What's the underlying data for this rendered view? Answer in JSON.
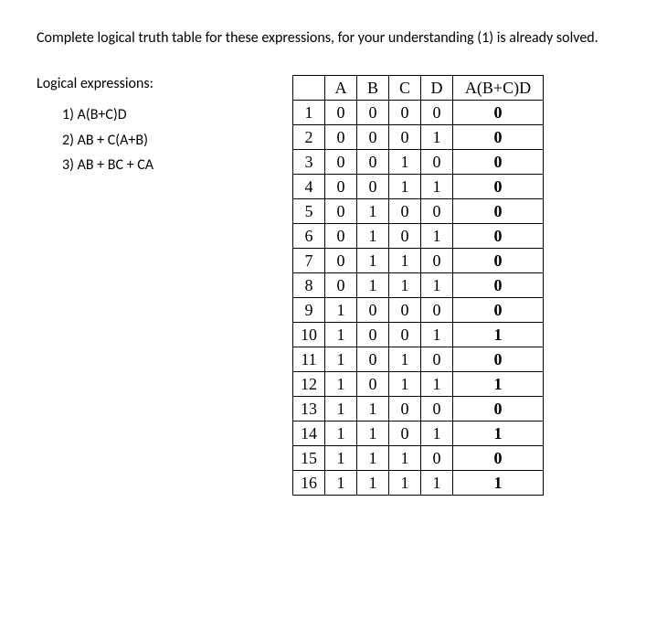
{
  "intro": "Complete logical truth table for these expressions, for your understanding (1) is already solved.",
  "subheading": "Logical expressions:",
  "expressions": [
    {
      "num": "1)",
      "text": "A(B+C)D"
    },
    {
      "num": "2)",
      "text": "AB + C(A+B)"
    },
    {
      "num": "3)",
      "text": "AB + BC + CA"
    }
  ],
  "table": {
    "headers": [
      "A",
      "B",
      "C",
      "D",
      "A(B+C)D"
    ],
    "rows": [
      {
        "n": "1",
        "A": "0",
        "B": "0",
        "C": "0",
        "D": "0",
        "R": "0"
      },
      {
        "n": "2",
        "A": "0",
        "B": "0",
        "C": "0",
        "D": "1",
        "R": "0"
      },
      {
        "n": "3",
        "A": "0",
        "B": "0",
        "C": "1",
        "D": "0",
        "R": "0"
      },
      {
        "n": "4",
        "A": "0",
        "B": "0",
        "C": "1",
        "D": "1",
        "R": "0"
      },
      {
        "n": "5",
        "A": "0",
        "B": "1",
        "C": "0",
        "D": "0",
        "R": "0"
      },
      {
        "n": "6",
        "A": "0",
        "B": "1",
        "C": "0",
        "D": "1",
        "R": "0"
      },
      {
        "n": "7",
        "A": "0",
        "B": "1",
        "C": "1",
        "D": "0",
        "R": "0"
      },
      {
        "n": "8",
        "A": "0",
        "B": "1",
        "C": "1",
        "D": "1",
        "R": "0"
      },
      {
        "n": "9",
        "A": "1",
        "B": "0",
        "C": "0",
        "D": "0",
        "R": "0"
      },
      {
        "n": "10",
        "A": "1",
        "B": "0",
        "C": "0",
        "D": "1",
        "R": "1"
      },
      {
        "n": "11",
        "A": "1",
        "B": "0",
        "C": "1",
        "D": "0",
        "R": "0"
      },
      {
        "n": "12",
        "A": "1",
        "B": "0",
        "C": "1",
        "D": "1",
        "R": "1"
      },
      {
        "n": "13",
        "A": "1",
        "B": "1",
        "C": "0",
        "D": "0",
        "R": "0"
      },
      {
        "n": "14",
        "A": "1",
        "B": "1",
        "C": "0",
        "D": "1",
        "R": "1"
      },
      {
        "n": "15",
        "A": "1",
        "B": "1",
        "C": "1",
        "D": "0",
        "R": "0"
      },
      {
        "n": "16",
        "A": "1",
        "B": "1",
        "C": "1",
        "D": "1",
        "R": "1"
      }
    ]
  }
}
